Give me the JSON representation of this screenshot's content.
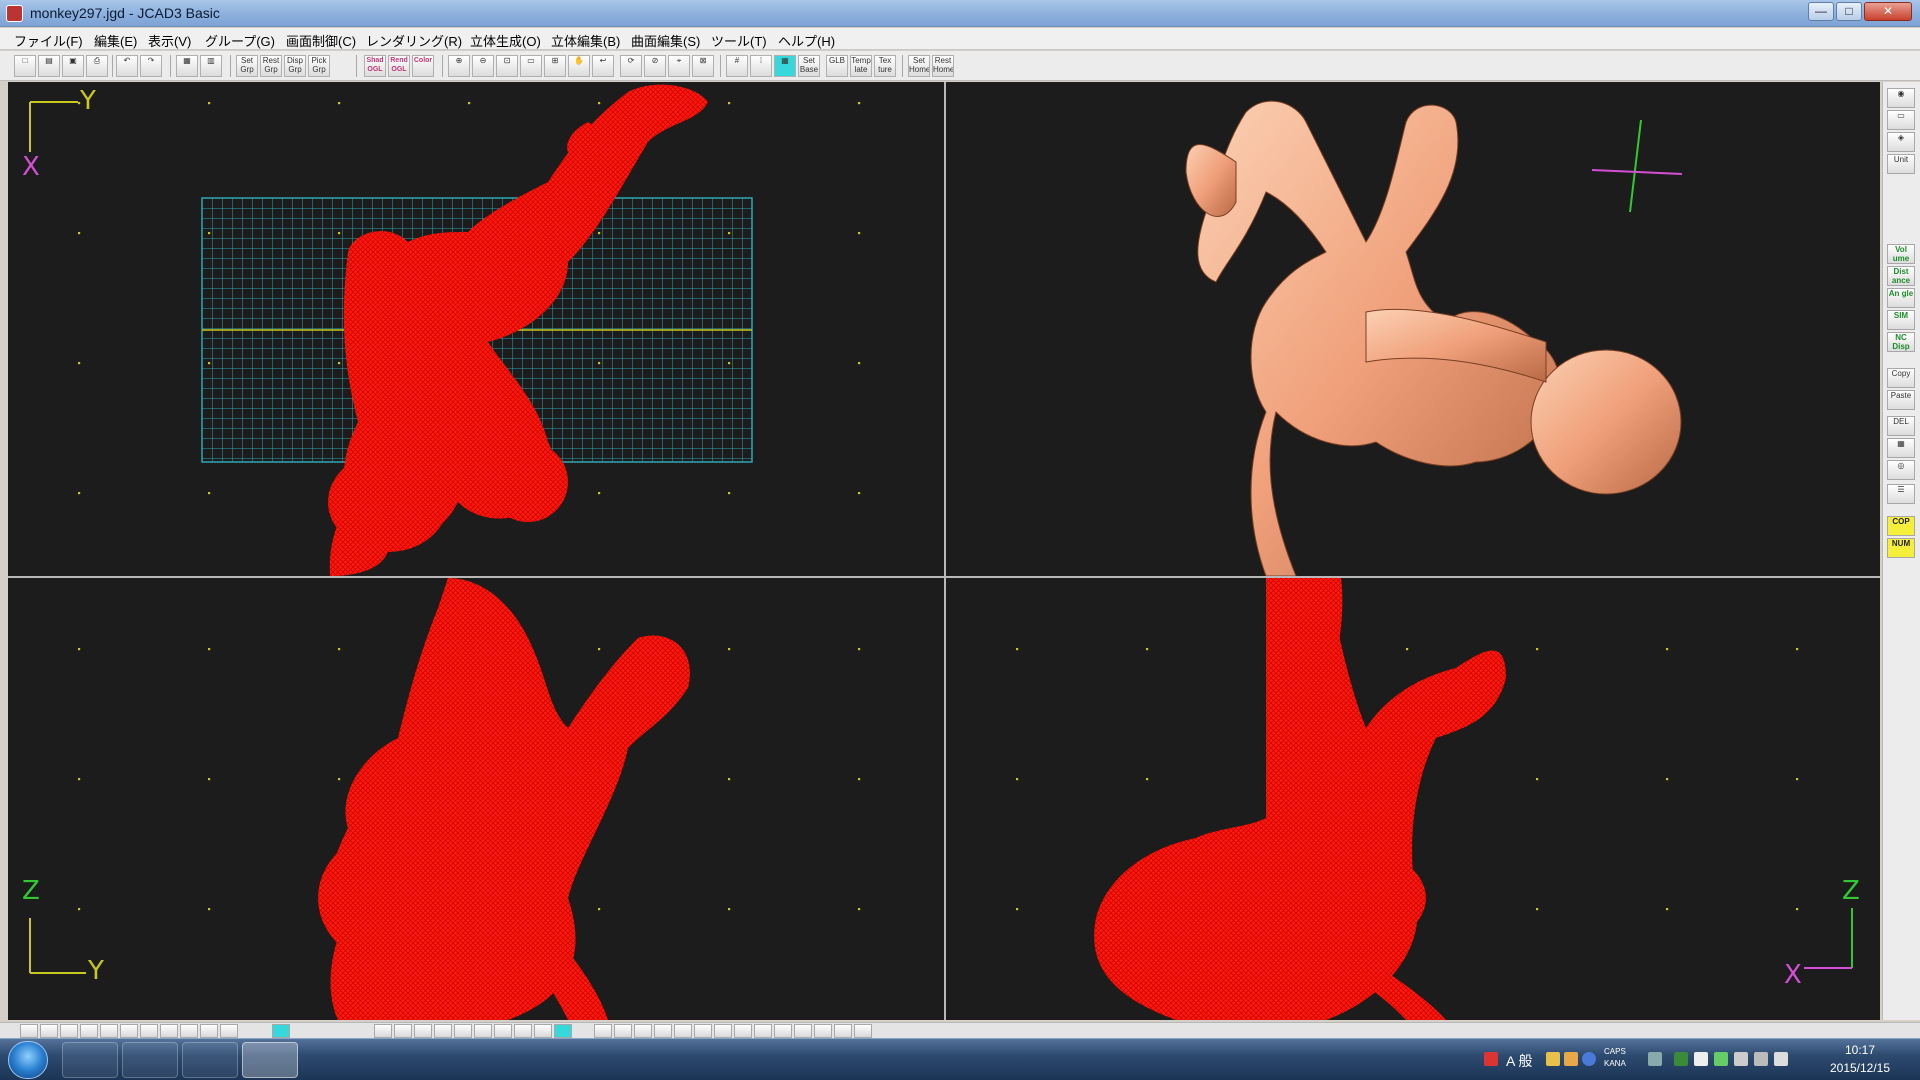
{
  "window": {
    "title": "monkey297.jgd - JCAD3 Basic",
    "minimize_label": "—",
    "maximize_label": "□",
    "close_label": "✕"
  },
  "menu": [
    "ファイル(F)",
    "編集(E)",
    "表示(V)",
    "グループ(G)",
    "画面制御(C)",
    "レンダリング(R)",
    "立体生成(O)",
    "立体編集(B)",
    "曲面編集(S)",
    "ツール(T)",
    "ヘルプ(H)"
  ],
  "toolbar": {
    "set_grp": "Set Grp",
    "rest_grp": "Rest Grp",
    "disp_grp": "Disp Grp",
    "pick_grp": "Pick Grp",
    "shad_ogl": "Shad OGL",
    "rend_ogl": "Rend OGL",
    "color": "Color",
    "set_base": "Set Base",
    "glb": "GLB",
    "template": "Temp late",
    "texture": "Tex ture",
    "set_home": "Set Home",
    "rest_home": "Rest Home"
  },
  "viewports": {
    "top_left": {
      "axis_up": "Y",
      "axis_left": "X"
    },
    "bottom_left": {
      "axis_up": "Z",
      "axis_right": "Y"
    },
    "bottom_right": {
      "axis_up": "Z",
      "axis_left": "X"
    }
  },
  "right_palette": {
    "unit": "Unit",
    "volume": "Vol ume",
    "distance": "Dist ance",
    "angle": "An gle",
    "sim": "SIM",
    "nc_disp": "NC Disp",
    "copy": "Copy",
    "paste": "Paste",
    "del": "DEL",
    "cop": "COP",
    "num": "NUM"
  },
  "taskbar": {
    "ime_mode": "A 般",
    "caps": "CAPS",
    "kana": "KANA",
    "time": "10:17",
    "date": "2015/12/15"
  },
  "colors": {
    "wireframe": "#ff1a0a",
    "rendered": "#f0a07a",
    "grid_box": "#2fa6b3",
    "axis_yellow": "#c8c81e",
    "axis_x": "#d54fd6",
    "axis_y": "#33c833"
  }
}
